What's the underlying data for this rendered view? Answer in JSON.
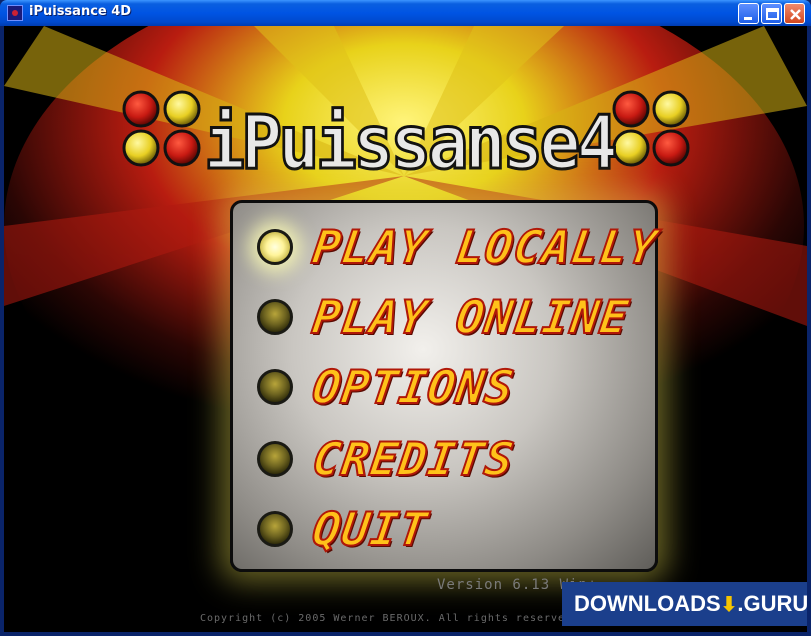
{
  "window": {
    "title": "iPuissance 4D"
  },
  "logo": {
    "main": "iPuissanse4"
  },
  "menu": {
    "items": [
      {
        "label": "PLAY LOCALLY",
        "lit": true
      },
      {
        "label": "PLAY ONLINE",
        "lit": false
      },
      {
        "label": "OPTIONS",
        "lit": false
      },
      {
        "label": "CREDITS",
        "lit": false
      },
      {
        "label": "QUIT",
        "lit": false
      }
    ]
  },
  "footer": {
    "version": "Version 6.13 Win+",
    "copyright": "Copyright (c) 2005 Werner BEROUX. All rights reserved."
  },
  "watermark": {
    "left": "DOWNLOADS",
    "right": ".GURU"
  },
  "colors": {
    "menu_text": "#ffc21a",
    "menu_outline": "#b01808",
    "disc_red": "#c81a12",
    "disc_yellow": "#e8cf22",
    "watermark_bg": "#1b3f8c"
  }
}
